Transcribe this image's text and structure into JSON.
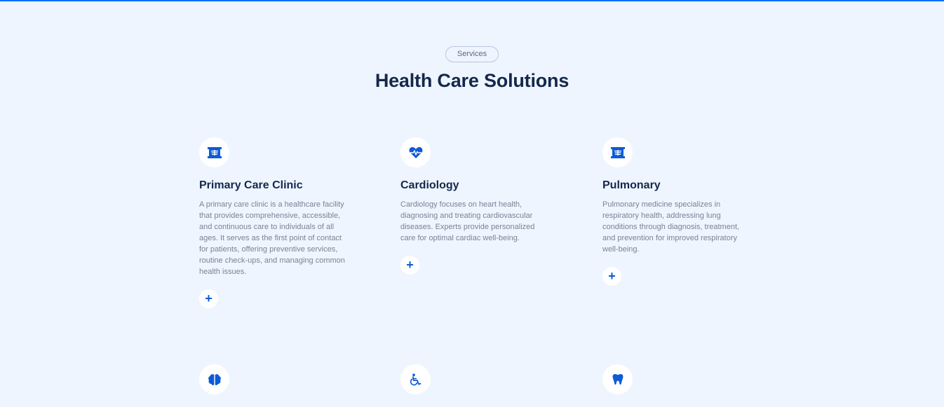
{
  "section": {
    "badge": "Services",
    "title": "Health Care Solutions"
  },
  "services": [
    {
      "title": "Primary Care Clinic",
      "description": "A primary care clinic is a healthcare facility that provides comprehensive, accessible, and continuous care to individuals of all ages. It serves as the first point of contact for patients, offering preventive services, routine check-ups, and managing common health issues.",
      "icon": "x-ray-icon",
      "action": "+"
    },
    {
      "title": "Cardiology",
      "description": "Cardiology focuses on heart health, diagnosing and treating cardiovascular diseases. Experts provide personalized care for optimal cardiac well-being.",
      "icon": "heart-pulse-icon",
      "action": "+"
    },
    {
      "title": "Pulmonary",
      "description": "Pulmonary medicine specializes in respiratory health, addressing lung conditions through diagnosis, treatment, and prevention for improved respiratory well-being.",
      "icon": "x-ray-icon",
      "action": "+"
    }
  ],
  "more_services_icons": [
    "brain-icon",
    "wheelchair-icon",
    "tooth-icon"
  ],
  "colors": {
    "accent": "#0d5bd7",
    "background": "#eef5ff",
    "heading": "#15284b",
    "body_text": "#7b8294"
  }
}
